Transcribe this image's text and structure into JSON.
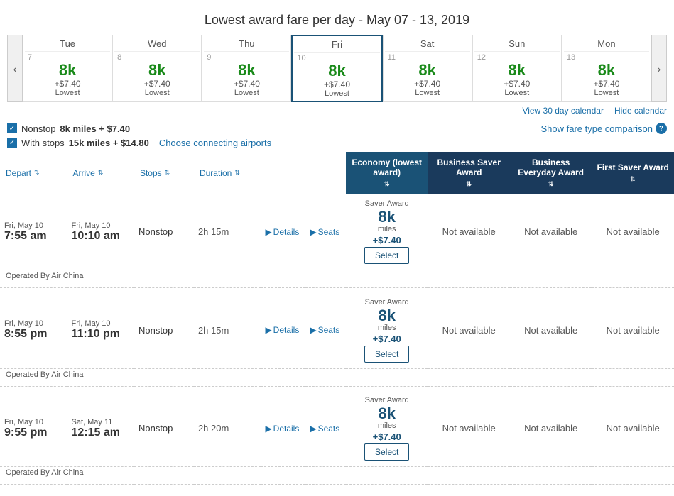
{
  "title": "Lowest award fare per day - May 07 - 13, 2019",
  "calendar": {
    "prev_arrow": "‹",
    "next_arrow": "›",
    "days": [
      {
        "name": "Tue",
        "num": "7",
        "miles": "8k",
        "fee": "+$7.40",
        "label": "Lowest",
        "selected": false
      },
      {
        "name": "Wed",
        "num": "8",
        "miles": "8k",
        "fee": "+$7.40",
        "label": "Lowest",
        "selected": false
      },
      {
        "name": "Thu",
        "num": "9",
        "miles": "8k",
        "fee": "+$7.40",
        "label": "Lowest",
        "selected": false
      },
      {
        "name": "Fri",
        "num": "10",
        "miles": "8k",
        "fee": "+$7.40",
        "label": "Lowest",
        "selected": true
      },
      {
        "name": "Sat",
        "num": "11",
        "miles": "8k",
        "fee": "+$7.40",
        "label": "Lowest",
        "selected": false
      },
      {
        "name": "Sun",
        "num": "12",
        "miles": "8k",
        "fee": "+$7.40",
        "label": "Lowest",
        "selected": false
      },
      {
        "name": "Mon",
        "num": "13",
        "miles": "8k",
        "fee": "+$7.40",
        "label": "Lowest",
        "selected": false
      }
    ],
    "view_30_day": "View 30 day calendar",
    "hide_calendar": "Hide calendar"
  },
  "filters": {
    "nonstop_label": "Nonstop",
    "nonstop_miles": "8k miles + $7.40",
    "with_stops_label": "With stops",
    "with_stops_miles": "15k miles + $14.80",
    "connecting_link": "Choose connecting airports",
    "fare_comparison_link": "Show fare type comparison",
    "info_icon": "?"
  },
  "columns": {
    "depart": "Depart",
    "arrive": "Arrive",
    "stops": "Stops",
    "duration": "Duration",
    "economy": "Economy (lowest award)",
    "biz_saver": "Business Saver Award",
    "biz_everyday": "Business Everyday Award",
    "first_saver": "First Saver Award",
    "sort_icon": "⇅"
  },
  "flights": [
    {
      "depart_date": "Fri, May 10",
      "depart_time": "7:55 am",
      "arrive_date": "Fri, May 10",
      "arrive_time": "10:10 am",
      "stops": "Nonstop",
      "duration": "2h 15m",
      "operated_by": "Operated By Air China",
      "award_type": "Saver Award",
      "miles": "8k",
      "miles_unit": "miles",
      "fee": "+$7.40",
      "select_label": "Select",
      "biz_saver": "Not available",
      "biz_everyday": "Not available",
      "first_saver": "Not available"
    },
    {
      "depart_date": "Fri, May 10",
      "depart_time": "8:55 pm",
      "arrive_date": "Fri, May 10",
      "arrive_time": "11:10 pm",
      "stops": "Nonstop",
      "duration": "2h 15m",
      "operated_by": "Operated By Air China",
      "award_type": "Saver Award",
      "miles": "8k",
      "miles_unit": "miles",
      "fee": "+$7.40",
      "select_label": "Select",
      "biz_saver": "Not available",
      "biz_everyday": "Not available",
      "first_saver": "Not available"
    },
    {
      "depart_date": "Fri, May 10",
      "depart_time": "9:55 pm",
      "arrive_date": "Sat, May 11",
      "arrive_time": "12:15 am",
      "stops": "Nonstop",
      "duration": "2h 20m",
      "operated_by": "Operated By Air China",
      "award_type": "Saver Award",
      "miles": "8k",
      "miles_unit": "miles",
      "fee": "+$7.40",
      "select_label": "Select",
      "biz_saver": "Not available",
      "biz_everyday": "Not available",
      "first_saver": "Not available"
    }
  ]
}
